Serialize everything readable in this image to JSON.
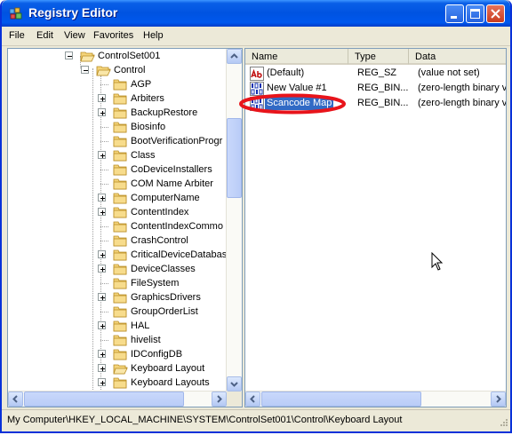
{
  "window": {
    "title": "Registry Editor",
    "title_bar_color": "#0054e3"
  },
  "menu": {
    "items": [
      "File",
      "Edit",
      "View",
      "Favorites",
      "Help"
    ]
  },
  "tree": {
    "items": [
      {
        "label": "ControlSet001",
        "expanded": true
      },
      {
        "label": "Control",
        "expanded": true
      },
      {
        "label": "AGP",
        "expandable": false
      },
      {
        "label": "Arbiters",
        "expandable": true
      },
      {
        "label": "BackupRestore",
        "expandable": true
      },
      {
        "label": "Biosinfo",
        "expandable": false
      },
      {
        "label": "BootVerificationProgr",
        "expandable": false
      },
      {
        "label": "Class",
        "expandable": true
      },
      {
        "label": "CoDeviceInstallers",
        "expandable": false
      },
      {
        "label": "COM Name Arbiter",
        "expandable": false
      },
      {
        "label": "ComputerName",
        "expandable": true
      },
      {
        "label": "ContentIndex",
        "expandable": true
      },
      {
        "label": "ContentIndexCommo",
        "expandable": false
      },
      {
        "label": "CrashControl",
        "expandable": false
      },
      {
        "label": "CriticalDeviceDatabas",
        "expandable": true
      },
      {
        "label": "DeviceClasses",
        "expandable": true
      },
      {
        "label": "FileSystem",
        "expandable": false
      },
      {
        "label": "GraphicsDrivers",
        "expandable": true
      },
      {
        "label": "GroupOrderList",
        "expandable": false
      },
      {
        "label": "HAL",
        "expandable": true
      },
      {
        "label": "hivelist",
        "expandable": false
      },
      {
        "label": "IDConfigDB",
        "expandable": true
      },
      {
        "label": "Keyboard Layout",
        "expandable": true,
        "open_folder": true
      },
      {
        "label": "Keyboard Layouts",
        "expandable": true
      }
    ]
  },
  "list": {
    "columns": {
      "name": "Name",
      "type": "Type",
      "data": "Data"
    },
    "rows": [
      {
        "name": "(Default)",
        "type": "REG_SZ",
        "data": "(value not set)",
        "icon": "string-value-icon"
      },
      {
        "name": "New Value #1",
        "type": "REG_BIN...",
        "data": "(zero-length binary v",
        "icon": "binary-value-icon"
      },
      {
        "name": "Scancode Map",
        "type": "REG_BIN...",
        "data": "(zero-length binary v",
        "icon": "binary-value-icon",
        "selected": true
      }
    ]
  },
  "status": {
    "path": "My Computer\\HKEY_LOCAL_MACHINE\\SYSTEM\\ControlSet001\\Control\\Keyboard Layout"
  },
  "colors": {
    "selection": "#316ac5",
    "highlight_ring": "#e8141b",
    "folder": "#f4d47a"
  }
}
